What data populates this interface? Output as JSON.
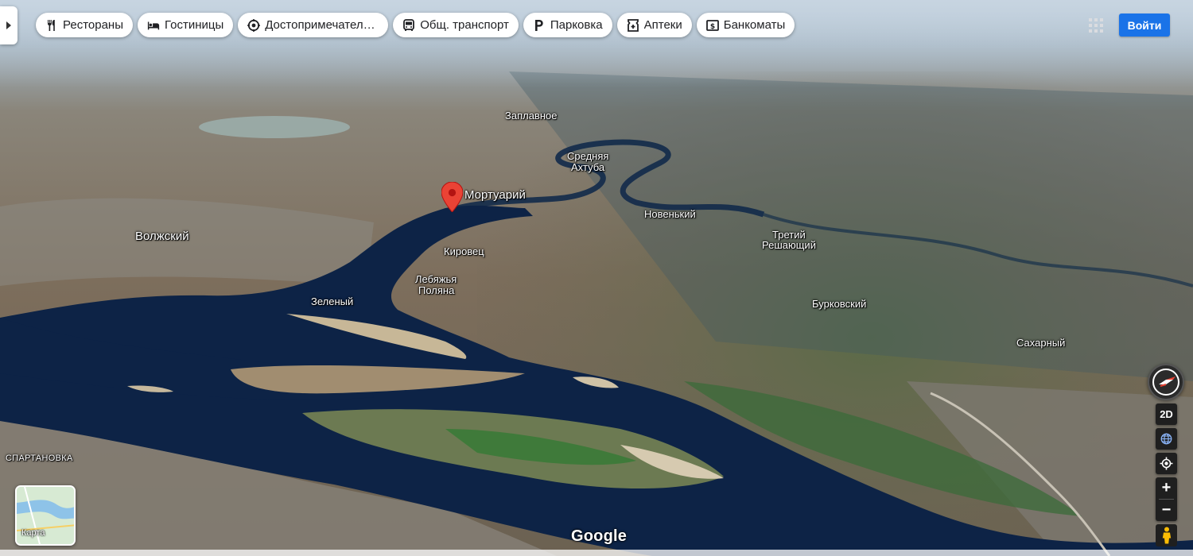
{
  "chips": [
    {
      "label": "Рестораны",
      "icon": "fork-knife-icon"
    },
    {
      "label": "Гостиницы",
      "icon": "bed-icon"
    },
    {
      "label": "Достопримечатель...",
      "icon": "landmark-icon"
    },
    {
      "label": "Общ. транспорт",
      "icon": "bus-icon"
    },
    {
      "label": "Парковка",
      "icon": "parking-icon"
    },
    {
      "label": "Аптеки",
      "icon": "pharmacy-icon"
    },
    {
      "label": "Банкоматы",
      "icon": "atm-icon"
    }
  ],
  "header": {
    "signin_label": "Войти",
    "apps_icon": "apps-grid-icon"
  },
  "pin": {
    "label": "Мортуарий",
    "color": "#ea4335"
  },
  "places": {
    "zaplavnoe": "Заплавное",
    "srednyaya": "Средняя",
    "akhtuba": "Ахтуба",
    "volzhsky": "Волжский",
    "novenky": "Новенький",
    "tretiy": "Третий",
    "reshayushchiy": "Решающий",
    "kirovets": "Кировец",
    "lebyazhya": "Лебяжья",
    "polyana": "Поляна",
    "zeleny": "Зеленый",
    "burkovsky": "Бурковский",
    "sakharny": "Сахарный",
    "spartanovka": "СПАРТАНОВКА"
  },
  "controls": {
    "view_mode_label": "2D",
    "zoom_in_label": "+",
    "zoom_out_label": "−"
  },
  "layer": {
    "label": "Карта"
  },
  "brand": "Google",
  "colors": {
    "accent": "#1a73e8",
    "water": "#0d2346",
    "chip_bg": "#ffffff"
  }
}
